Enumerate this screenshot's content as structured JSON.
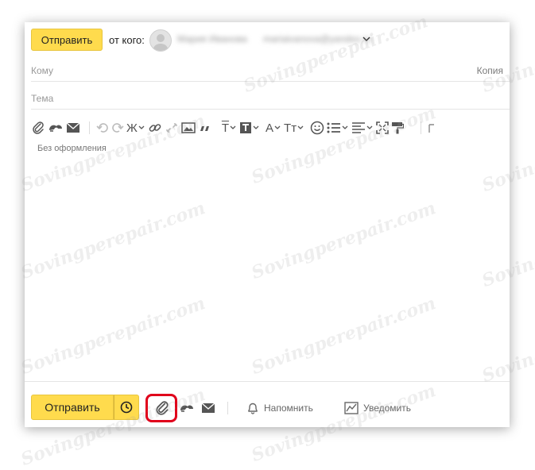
{
  "compose": {
    "send_label": "Отправить",
    "from_label": "от кого:",
    "from_name": "Мария Иванова",
    "from_email": "mariaivanova@yandex.ru",
    "to_label": "Кому",
    "copy_label": "Копия",
    "subject_label": "Тема",
    "format_label": "Без оформления"
  },
  "toolbar": {
    "bold_letter": "Ж",
    "font_letter": "A",
    "font_size_letter": "Тт",
    "text_format_letter": "Т"
  },
  "bottom": {
    "send_label": "Отправить",
    "remind_label": "Напомнить",
    "notify_label": "Уведомить"
  },
  "watermark": "Sovingperepair.com",
  "colors": {
    "accent_yellow": "#ffdb4d",
    "highlight_red": "#e0001b"
  }
}
